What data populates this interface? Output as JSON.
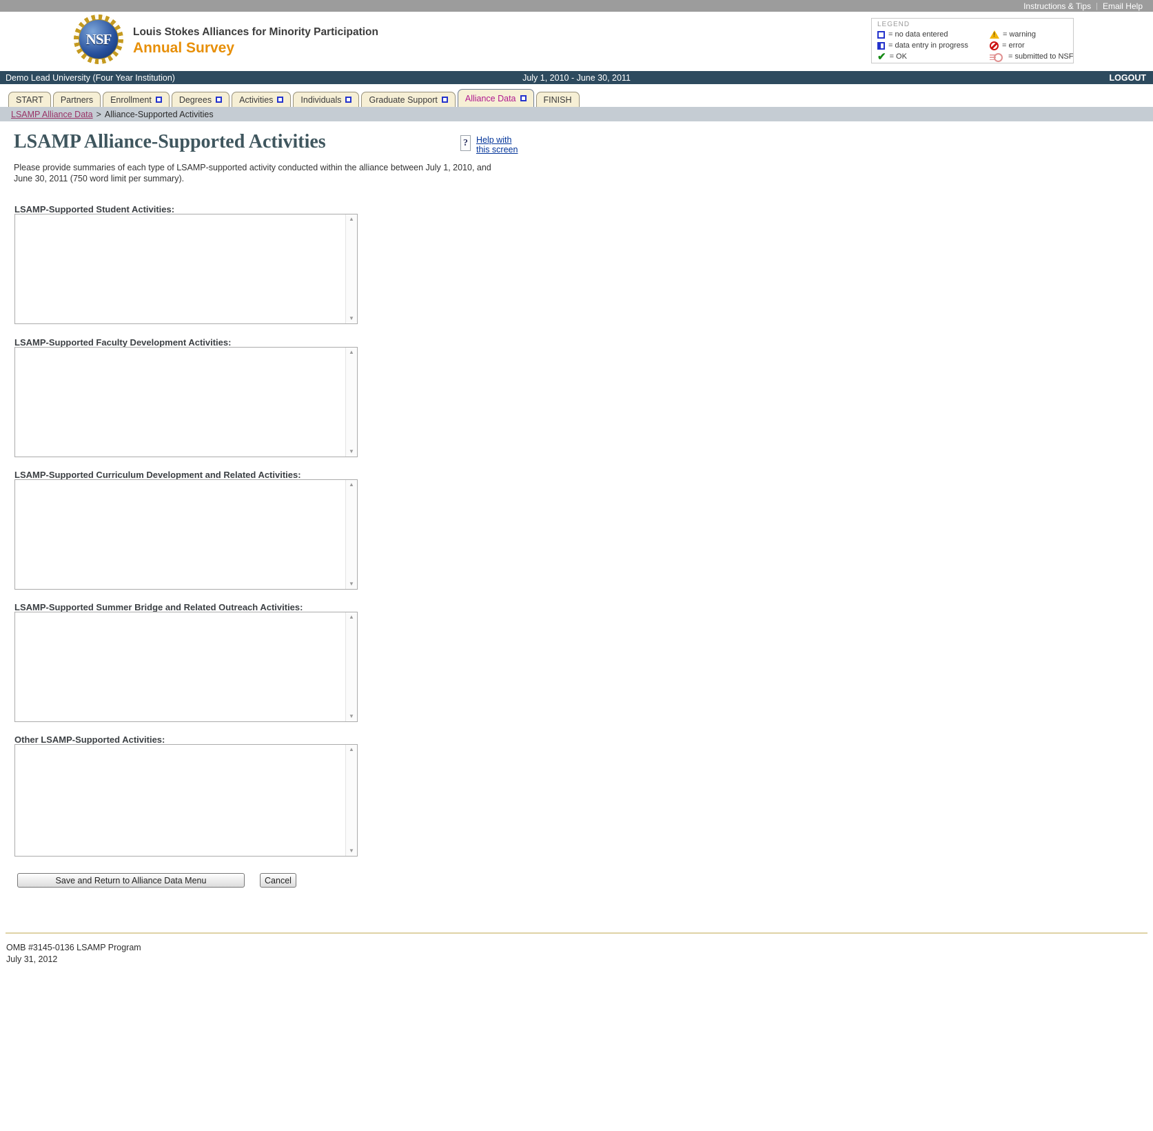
{
  "top_bar": {
    "links": [
      "Instructions & Tips",
      "Email Help"
    ],
    "separator": "|"
  },
  "header": {
    "logo_text": "NSF",
    "org_name": "Louis Stokes Alliances for Minority Participation",
    "app_name": "Annual Survey"
  },
  "legend": {
    "title": "LEGEND",
    "items": [
      {
        "icon": "empty-checkbox-icon",
        "label": "= no data entered"
      },
      {
        "icon": "half-filled-checkbox-icon",
        "label": "= data entry in progress"
      },
      {
        "icon": "green-check-icon",
        "label": "= OK"
      },
      {
        "icon": "warning-triangle-icon",
        "label": "= warning"
      },
      {
        "icon": "error-circle-icon",
        "label": "= error"
      },
      {
        "icon": "submitted-icon",
        "label": "= submitted to NSF"
      }
    ]
  },
  "info_bar": {
    "institution": "Demo Lead University (Four Year Institution)",
    "period": "July 1, 2010 - June 30, 2011",
    "logout": "LOGOUT"
  },
  "tabs": [
    {
      "label": "START",
      "checkbox": false,
      "active": false
    },
    {
      "label": "Partners",
      "checkbox": false,
      "active": false
    },
    {
      "label": "Enrollment",
      "checkbox": true,
      "active": false
    },
    {
      "label": "Degrees",
      "checkbox": true,
      "active": false
    },
    {
      "label": "Activities",
      "checkbox": true,
      "active": false
    },
    {
      "label": "Individuals",
      "checkbox": true,
      "active": false
    },
    {
      "label": "Graduate Support",
      "checkbox": true,
      "active": false
    },
    {
      "label": "Alliance Data",
      "checkbox": true,
      "active": true
    },
    {
      "label": "FINISH",
      "checkbox": false,
      "active": false
    }
  ],
  "breadcrumb": {
    "link": "LSAMP Alliance Data",
    "separator": ">",
    "current": "Alliance-Supported Activities"
  },
  "page": {
    "title": "LSAMP Alliance-Supported Activities",
    "help_icon": "?",
    "help_link": "Help with this screen",
    "instructions": "Please provide summaries of each type of LSAMP-supported activity conducted within the alliance between July 1, 2010, and June 30, 2011 (750 word limit per summary)."
  },
  "form": {
    "fields": [
      {
        "label": "LSAMP-Supported Student Activities:",
        "value": ""
      },
      {
        "label": "LSAMP-Supported Faculty Development Activities:",
        "value": ""
      },
      {
        "label": "LSAMP-Supported Curriculum Development and Related Activities:",
        "value": ""
      },
      {
        "label": "LSAMP-Supported Summer Bridge and Related Outreach Activities:",
        "value": ""
      },
      {
        "label": "Other LSAMP-Supported Activities:",
        "value": ""
      }
    ],
    "save_button": "Save and Return to Alliance Data Menu",
    "cancel_button": "Cancel"
  },
  "footer": {
    "line1": "OMB #3145-0136 LSAMP Program",
    "line2": "July 31, 2012"
  },
  "colors": {
    "brand_orange": "#e78f08",
    "header_bar_blue": "#2d4a5e",
    "active_tab_magenta": "#b0188f",
    "tab_background": "#f6efd5",
    "breadcrumb_background": "#c5ccd3",
    "breadcrumb_link": "#993366",
    "legend_ok_green": "#168a16",
    "legend_warning_yellow": "#f2b407",
    "legend_error_red": "#cc1111",
    "legend_progress_blue": "#2433cc",
    "submitted_pink": "#e09090",
    "footer_rule_tan": "#dfd3a5"
  }
}
